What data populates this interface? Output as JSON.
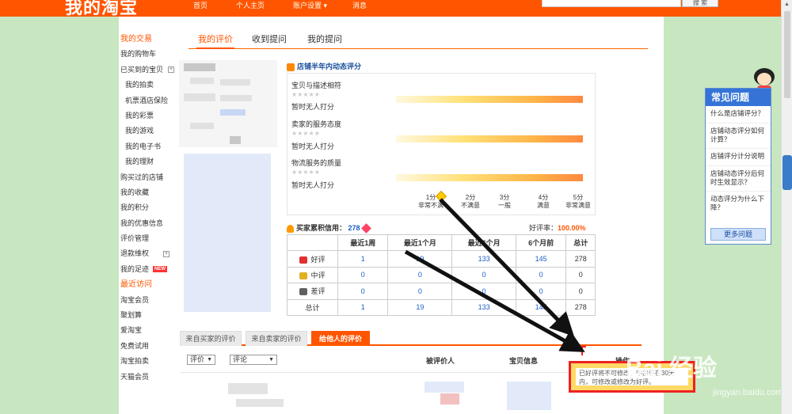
{
  "header": {
    "logo": "我的淘宝",
    "nav": [
      "首页",
      "个人主页",
      "账户设置 ▾",
      "消息"
    ],
    "search_button": "搜 索"
  },
  "main_tabs": [
    "我的评价",
    "收到提问",
    "我的提问"
  ],
  "left_nav": {
    "section1_title": "我的交易",
    "items": [
      {
        "label": "我的购物车",
        "sub": false
      },
      {
        "label": "已买到的宝贝",
        "sub": false,
        "expander": "+"
      },
      {
        "label": "我的拍卖",
        "sub": true
      },
      {
        "label": "机票酒店保险",
        "sub": true
      },
      {
        "label": "我的彩票",
        "sub": true
      },
      {
        "label": "我的游戏",
        "sub": true
      },
      {
        "label": "我的电子书",
        "sub": true
      },
      {
        "label": "我的理财",
        "sub": true
      },
      {
        "label": "购买过的店铺",
        "sub": false
      },
      {
        "label": "我的收藏",
        "sub": false
      },
      {
        "label": "我的积分",
        "sub": false
      },
      {
        "label": "我的优惠信息",
        "sub": false
      },
      {
        "label": "评价管理",
        "sub": false
      },
      {
        "label": "退款维权",
        "sub": false,
        "expander": "+"
      },
      {
        "label": "我的足迹",
        "sub": false,
        "badge": "NEW"
      }
    ],
    "section2_title": "最近访问",
    "recent": [
      "淘宝会员",
      "聚划算",
      "爱淘宝",
      "免费试用",
      "淘宝拍卖",
      "天猫会员"
    ]
  },
  "shop_rating": {
    "title": "店铺半年内动态评分",
    "criteria": [
      {
        "label": "宝贝与描述相符",
        "stars": "★★★★★",
        "status": "暂时无人打分"
      },
      {
        "label": "卖家的服务态度",
        "stars": "★★★★★",
        "status": "暂时无人打分"
      },
      {
        "label": "物流服务的质量",
        "stars": "★★★★★",
        "status": "暂时无人打分"
      }
    ],
    "scale": [
      {
        "score": "1分",
        "desc": "非常不满"
      },
      {
        "score": "2分",
        "desc": "不满意"
      },
      {
        "score": "3分",
        "desc": "一般"
      },
      {
        "score": "4分",
        "desc": "满意"
      },
      {
        "score": "5分",
        "desc": "非常满意"
      }
    ]
  },
  "credit": {
    "label": "买家累积信用：",
    "score": "278",
    "good_rate_label": "好评率：",
    "good_rate": "100.00%"
  },
  "stats_table": {
    "headers": [
      "",
      "最近1周",
      "最近1个月",
      "最近6个月",
      "6个月前",
      "总计"
    ],
    "rows": [
      {
        "label": "好评",
        "icon_color": "#e03030",
        "values": [
          "1",
          "19",
          "133",
          "145",
          "278"
        ]
      },
      {
        "label": "中评",
        "icon_color": "#e0b020",
        "values": [
          "0",
          "0",
          "0",
          "0",
          "0"
        ]
      },
      {
        "label": "差评",
        "icon_color": "#606060",
        "values": [
          "0",
          "0",
          "0",
          "0",
          "0"
        ]
      },
      {
        "label": "总计",
        "icon_color": "",
        "values": [
          "1",
          "19",
          "133",
          "145",
          "278"
        ]
      }
    ]
  },
  "review_tabs": [
    "来自买家的评价",
    "来自卖家的评价",
    "给他人的评价"
  ],
  "filters": {
    "rating_select": "评价",
    "comment_select": "评论"
  },
  "list_headers": {
    "reviewee": "被评价人",
    "item_info": "宝贝信息",
    "op": "操作"
  },
  "tooltip_text": "已好评将不可修改，中差评在30天内，可修改或修改为好评。",
  "faq": {
    "title": "常见问题",
    "questions": [
      "什么是店铺评分？",
      "店铺动态评分如何计算？",
      "店铺评分计分说明",
      "店铺动态评分后何时生效显示？",
      "动态评分为什么下降？"
    ],
    "more": "更多问题"
  },
  "watermark": {
    "brand": "Bai 经验",
    "url": "jingyan.baidu.com"
  }
}
